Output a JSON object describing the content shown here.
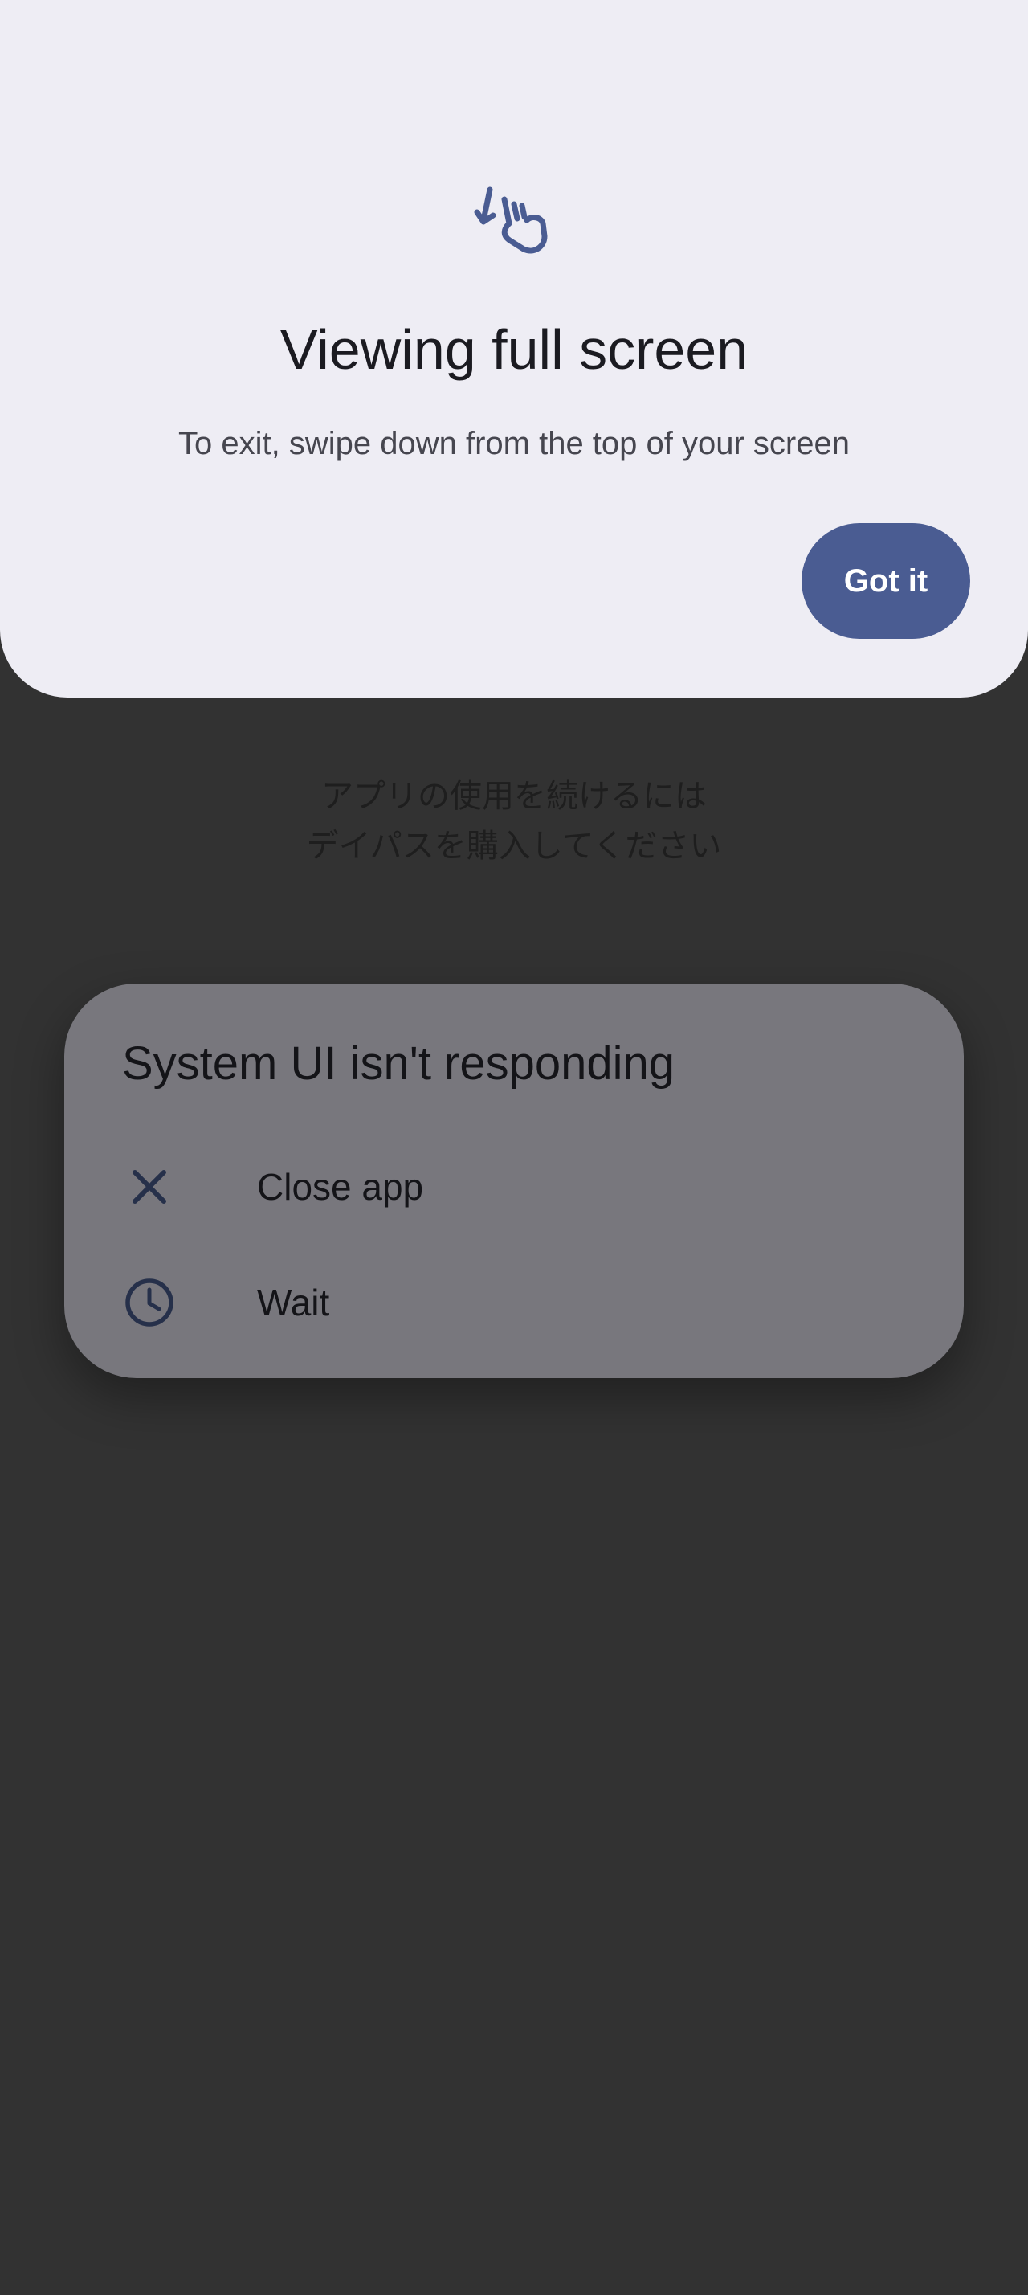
{
  "sheet": {
    "icon": "swipe-down-gesture-icon",
    "title": "Viewing full screen",
    "description": "To exit, swipe down from the top of your screen",
    "button_label": "Got it"
  },
  "background": {
    "message_lines": [
      "アプリの使用を続けるには",
      "デイパスを購入してください"
    ]
  },
  "dialog": {
    "title": "System UI isn't responding",
    "items": [
      {
        "label": "Close app",
        "icon": "close-icon"
      },
      {
        "label": "Wait",
        "icon": "clock-icon"
      }
    ]
  },
  "colors": {
    "sheet_background": "#eeedf4",
    "accent": "#4a5c92",
    "screen_background": "#323232",
    "dialog_background": "#78777d",
    "dialog_icon": "#26304a"
  }
}
